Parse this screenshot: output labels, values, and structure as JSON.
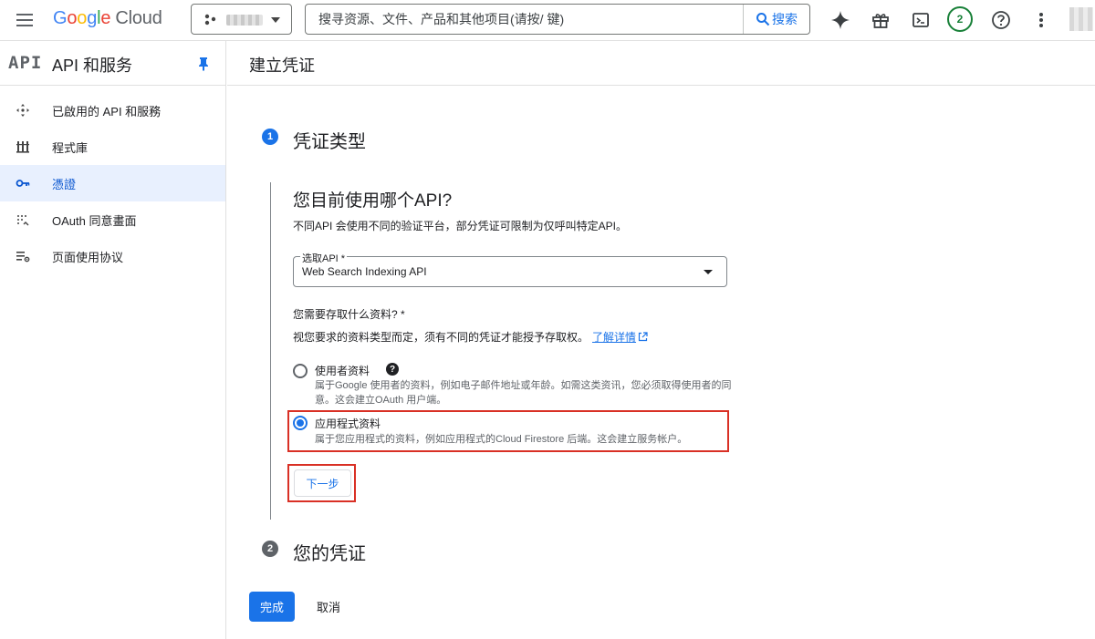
{
  "header": {
    "logo_google": [
      "G",
      "o",
      "o",
      "g",
      "l",
      "e"
    ],
    "logo_cloud": "Cloud",
    "search_placeholder": "搜寻资源、文件、产品和其他项目(请按/ 键)",
    "search_button": "搜索",
    "notification_count": "2"
  },
  "sidebar": {
    "logo": "API",
    "title": "API 和服务",
    "items": [
      {
        "label": "已啟用的 API 和服務",
        "icon": "api-services-icon",
        "active": false
      },
      {
        "label": "程式庫",
        "icon": "library-icon",
        "active": false
      },
      {
        "label": "憑證",
        "icon": "key-icon",
        "active": true
      },
      {
        "label": "OAuth 同意畫面",
        "icon": "oauth-consent-icon",
        "active": false
      },
      {
        "label": "页面使用协议",
        "icon": "page-usage-agreement-icon",
        "active": false
      }
    ]
  },
  "main": {
    "page_title": "建立凭证",
    "step1": {
      "number": "1",
      "title": "凭证类型",
      "question": "您目前使用哪个API?",
      "description": "不同API 会使用不同的验证平台，部分凭证可限制为仅呼叫特定API。",
      "select_label": "选取API *",
      "select_value": "Web Search Indexing API",
      "access_question": "您需要存取什么资料? *",
      "access_description": "视您要求的资料类型而定，须有不同的凭证才能授予存取权。",
      "learn_more": "了解详情",
      "options": [
        {
          "label": "使用者资料",
          "description": "属于Google 使用者的资料，例如电子邮件地址或年龄。如需这类资讯，您必须取得使用者的同意。这会建立OAuth 用户端。",
          "selected": false
        },
        {
          "label": "应用程式资料",
          "description": "属于您应用程式的资料，例如应用程式的Cloud Firestore 后端。这会建立服务帐户。",
          "selected": true
        }
      ],
      "next_button": "下一步"
    },
    "step2": {
      "number": "2",
      "title": "您的凭证"
    },
    "done_button": "完成",
    "cancel_button": "取消"
  },
  "colors": {
    "accent": "#1a73e8",
    "highlight": "#d93025",
    "active_nav_bg": "#e8f0fe",
    "notification": "#188038"
  }
}
